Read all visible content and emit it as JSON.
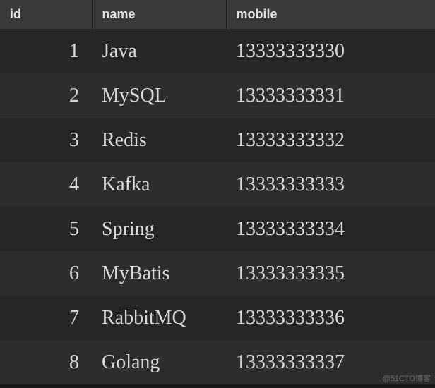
{
  "table": {
    "columns": [
      "id",
      "name",
      "mobile"
    ],
    "rows": [
      {
        "id": "1",
        "name": "Java",
        "mobile": "13333333330"
      },
      {
        "id": "2",
        "name": "MySQL",
        "mobile": "13333333331"
      },
      {
        "id": "3",
        "name": "Redis",
        "mobile": "13333333332"
      },
      {
        "id": "4",
        "name": "Kafka",
        "mobile": "13333333333"
      },
      {
        "id": "5",
        "name": "Spring",
        "mobile": "13333333334"
      },
      {
        "id": "6",
        "name": "MyBatis",
        "mobile": "13333333335"
      },
      {
        "id": "7",
        "name": "RabbitMQ",
        "mobile": "13333333336"
      },
      {
        "id": "8",
        "name": "Golang",
        "mobile": "13333333337"
      }
    ]
  },
  "watermark": "@51CTO博客"
}
